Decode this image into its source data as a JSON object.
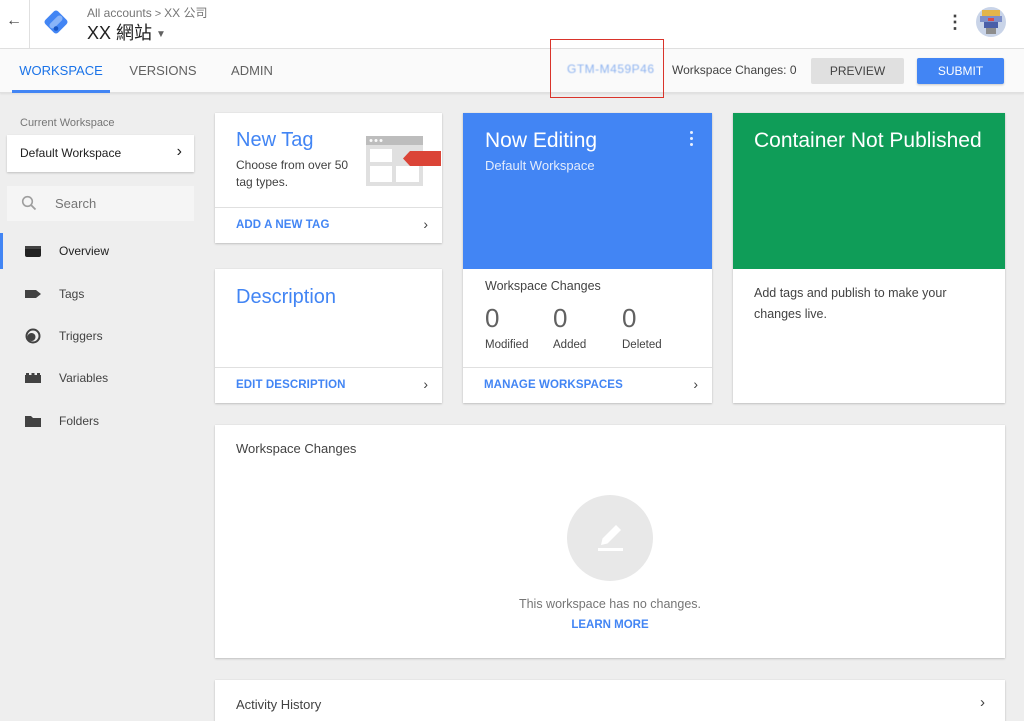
{
  "header": {
    "breadcrumb_all": "All accounts",
    "breadcrumb_sep": ">",
    "breadcrumb_account": "XX 公司",
    "container_name": "XX 網站"
  },
  "tabs": [
    {
      "label": "WORKSPACE",
      "active": true
    },
    {
      "label": "VERSIONS",
      "active": false
    },
    {
      "label": "ADMIN",
      "active": false
    }
  ],
  "toolbar": {
    "container_id": "GTM-M459P46",
    "workspace_changes": "Workspace Changes: 0",
    "preview_label": "PREVIEW",
    "submit_label": "SUBMIT"
  },
  "sidebar": {
    "current_workspace_label": "Current Workspace",
    "workspace_name": "Default Workspace",
    "search_placeholder": "Search",
    "items": [
      {
        "label": "Overview",
        "icon": "overview-icon",
        "active": true
      },
      {
        "label": "Tags",
        "icon": "tag-icon",
        "active": false
      },
      {
        "label": "Triggers",
        "icon": "trigger-icon",
        "active": false
      },
      {
        "label": "Variables",
        "icon": "variable-icon",
        "active": false
      },
      {
        "label": "Folders",
        "icon": "folder-icon",
        "active": false
      }
    ]
  },
  "new_tag_card": {
    "title": "New Tag",
    "description": "Choose from over 50 tag types.",
    "link": "ADD A NEW TAG"
  },
  "description_card": {
    "title": "Description",
    "link": "EDIT DESCRIPTION"
  },
  "now_editing_card": {
    "title": "Now Editing",
    "subtitle": "Default Workspace",
    "changes_title": "Workspace Changes",
    "stats": [
      {
        "value": "0",
        "label": "Modified"
      },
      {
        "value": "0",
        "label": "Added"
      },
      {
        "value": "0",
        "label": "Deleted"
      }
    ],
    "link": "MANAGE WORKSPACES"
  },
  "publish_card": {
    "title": "Container Not Published",
    "body": "Add tags and publish to make your changes live."
  },
  "workspace_changes_panel": {
    "title": "Workspace Changes",
    "empty_text": "This workspace has no changes.",
    "learn_more": "LEARN MORE"
  },
  "activity_history": {
    "title": "Activity History"
  },
  "colors": {
    "primary_blue": "#4285f4",
    "green": "#0f9d58",
    "highlight_red": "#d9342b"
  }
}
